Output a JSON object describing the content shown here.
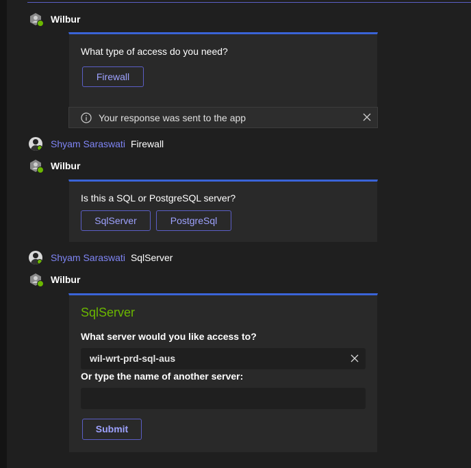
{
  "messages": [
    {
      "sender": "Wilbur"
    },
    {
      "sender": "Shyam Saraswati",
      "text": "Firewall"
    },
    {
      "sender": "Wilbur"
    },
    {
      "sender": "Shyam Saraswati",
      "text": "SqlServer"
    },
    {
      "sender": "Wilbur"
    }
  ],
  "card1": {
    "question": "What type of access do you need?",
    "button": "Firewall",
    "notice": "Your response was sent to the app"
  },
  "card2": {
    "question": "Is this a SQL or PostgreSQL server?",
    "buttons": [
      "SqlServer",
      "PostgreSql"
    ]
  },
  "card3": {
    "title": "SqlServer",
    "question": "What server would you like access to?",
    "selected_server": "wil-wrt-prd-sql-aus",
    "alt_label": "Or type the name of another server:",
    "alt_value": "",
    "submit": "Submit"
  },
  "colors": {
    "accent": "#5b5fc7",
    "card_border": "#3a64d8",
    "title_green": "#6bb700",
    "username": "#7f85f5"
  }
}
